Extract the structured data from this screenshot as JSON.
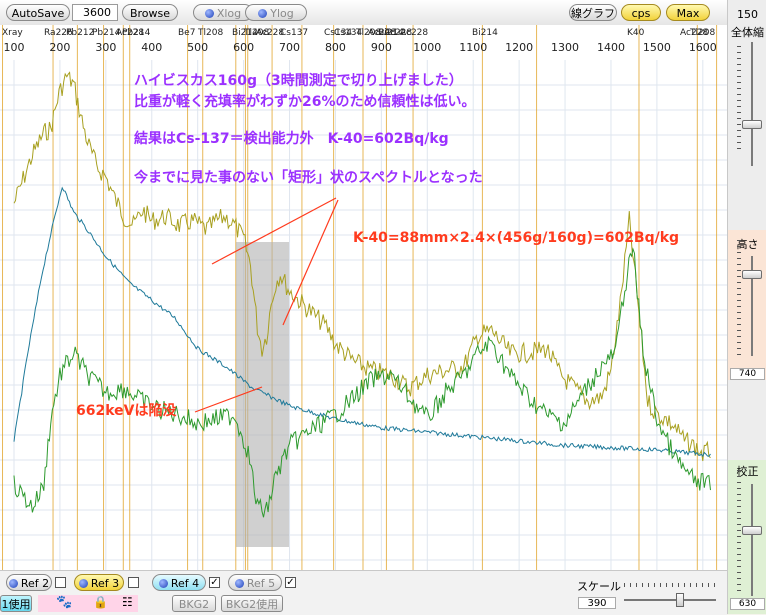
{
  "toolbar": {
    "autosave": "AutoSave",
    "time": "3600",
    "browse": "Browse",
    "xlog": "Xlog",
    "ylog": "Ylog",
    "line_graph": "線グラフ",
    "cps": "cps",
    "max": "Max"
  },
  "chart_data": {
    "type": "line",
    "x_axis_ticks": [
      "100",
      "200",
      "300",
      "400",
      "500",
      "600",
      "700",
      "800",
      "900",
      "1000",
      "1100",
      "1200",
      "1300",
      "1400",
      "1500",
      "1600"
    ],
    "nuclide_labels": [
      "Xray",
      "Ra226",
      "Pb212",
      "Pb214",
      "Ac228",
      "Pb214",
      "Be7",
      "Tl208",
      "Bi214",
      "Tl208",
      "Ac228",
      "Cs137",
      "Cs134",
      "Cs134",
      "Tl208",
      "Ac228",
      "Bi214",
      "Ac228",
      "Ac228",
      "Bi214",
      "K40",
      "Ac228",
      "Tl208"
    ],
    "series": [
      {
        "color": "#a8a020",
        "values": [
          [
            100,
            72
          ],
          [
            140,
            50
          ],
          [
            165,
            40
          ],
          [
            180,
            38
          ],
          [
            198,
            22
          ],
          [
            215,
            14
          ],
          [
            230,
            18
          ],
          [
            245,
            32
          ],
          [
            260,
            44
          ],
          [
            280,
            55
          ],
          [
            300,
            60
          ],
          [
            320,
            70
          ],
          [
            340,
            78
          ],
          [
            360,
            82
          ],
          [
            380,
            75
          ],
          [
            400,
            80
          ],
          [
            430,
            78
          ],
          [
            460,
            82
          ],
          [
            490,
            80
          ],
          [
            520,
            84
          ],
          [
            540,
            80
          ],
          [
            560,
            78
          ],
          [
            580,
            82
          ],
          [
            600,
            88
          ],
          [
            615,
            100
          ],
          [
            630,
            128
          ],
          [
            640,
            138
          ],
          [
            650,
            132
          ],
          [
            660,
            118
          ],
          [
            670,
            108
          ],
          [
            680,
            104
          ],
          [
            700,
            112
          ],
          [
            720,
            116
          ],
          [
            750,
            122
          ],
          [
            780,
            128
          ],
          [
            800,
            136
          ],
          [
            840,
            144
          ],
          [
            880,
            148
          ],
          [
            920,
            150
          ],
          [
            960,
            156
          ],
          [
            1000,
            150
          ],
          [
            1040,
            148
          ],
          [
            1080,
            146
          ],
          [
            1110,
            132
          ],
          [
            1140,
            130
          ],
          [
            1180,
            140
          ],
          [
            1220,
            140
          ],
          [
            1260,
            138
          ],
          [
            1290,
            150
          ],
          [
            1320,
            156
          ],
          [
            1350,
            162
          ],
          [
            1380,
            160
          ],
          [
            1400,
            148
          ],
          [
            1420,
            118
          ],
          [
            1440,
            80
          ],
          [
            1460,
            120
          ],
          [
            1480,
            162
          ],
          [
            1500,
            168
          ],
          [
            1520,
            170
          ],
          [
            1540,
            174
          ],
          [
            1560,
            180
          ],
          [
            1580,
            182
          ],
          [
            1600,
            186
          ],
          [
            1620,
            184
          ]
        ]
      },
      {
        "color": "#1f7a9a",
        "values": [
          [
            100,
            180
          ],
          [
            130,
            140
          ],
          [
            160,
            105
          ],
          [
            180,
            86
          ],
          [
            205,
            64
          ],
          [
            230,
            76
          ],
          [
            260,
            84
          ],
          [
            300,
            96
          ],
          [
            350,
            108
          ],
          [
            400,
            116
          ],
          [
            450,
            124
          ],
          [
            500,
            138
          ],
          [
            560,
            146
          ],
          [
            620,
            156
          ],
          [
            700,
            164
          ],
          [
            800,
            170
          ],
          [
            900,
            174
          ],
          [
            1000,
            176
          ],
          [
            1100,
            178
          ],
          [
            1200,
            180
          ],
          [
            1300,
            182
          ],
          [
            1400,
            183
          ],
          [
            1500,
            184
          ],
          [
            1600,
            186
          ],
          [
            1620,
            186
          ]
        ]
      },
      {
        "color": "#2e9a2e",
        "values": [
          [
            100,
            200
          ],
          [
            140,
            210
          ],
          [
            165,
            200
          ],
          [
            180,
            170
          ],
          [
            200,
            150
          ],
          [
            230,
            140
          ],
          [
            260,
            150
          ],
          [
            300,
            158
          ],
          [
            340,
            156
          ],
          [
            380,
            162
          ],
          [
            420,
            166
          ],
          [
            460,
            168
          ],
          [
            500,
            172
          ],
          [
            540,
            170
          ],
          [
            580,
            168
          ],
          [
            610,
            185
          ],
          [
            630,
            210
          ],
          [
            650,
            212
          ],
          [
            670,
            196
          ],
          [
            700,
            182
          ],
          [
            740,
            176
          ],
          [
            800,
            168
          ],
          [
            840,
            160
          ],
          [
            880,
            152
          ],
          [
            920,
            150
          ],
          [
            960,
            160
          ],
          [
            1000,
            170
          ],
          [
            1040,
            158
          ],
          [
            1080,
            150
          ],
          [
            1110,
            140
          ],
          [
            1140,
            135
          ],
          [
            1180,
            150
          ],
          [
            1220,
            160
          ],
          [
            1260,
            168
          ],
          [
            1300,
            172
          ],
          [
            1340,
            158
          ],
          [
            1380,
            146
          ],
          [
            1410,
            140
          ],
          [
            1430,
            110
          ],
          [
            1448,
            92
          ],
          [
            1470,
            140
          ],
          [
            1500,
            170
          ],
          [
            1540,
            188
          ],
          [
            1580,
            198
          ],
          [
            1620,
            200
          ]
        ]
      }
    ]
  },
  "annotations": {
    "line1": "ハイビスカス160g（3時間測定で切り上げました）",
    "line2": "比重が軽く充填率がわずか26%のため信頼性は低い。",
    "line3": "結果はCs-137＝検出能力外　K-40=602Bq/kg",
    "line4": "今までに見た事のない「矩形」状のスペクトルとなった",
    "k40_formula": "K-40=88mm×2.4×(456g/160g)=602Bq/kg",
    "dip_note": "662keVは陥没"
  },
  "right_panel": {
    "zoom_value": "150",
    "zoom_label": "全体縮",
    "height_label": "高さ",
    "height_value": "740",
    "calib_label": "校正",
    "calib_value": "630"
  },
  "bottom": {
    "ref2": "Ref 2",
    "ref3": "Ref 3",
    "ref4": "Ref 4",
    "ref5": "Ref 5",
    "use1": "1使用",
    "bkg2": "BKG2",
    "bkg2_use": "BKG2使用",
    "scale_label": "スケール",
    "scale_value": "390"
  },
  "colors": {
    "plot_bg": "#ffffff",
    "nuclide_line": "#e0a020",
    "annotation_purple": "#9b30ff",
    "annotation_red": "#ff3b1e",
    "gray_box": "#b0b0b0"
  }
}
